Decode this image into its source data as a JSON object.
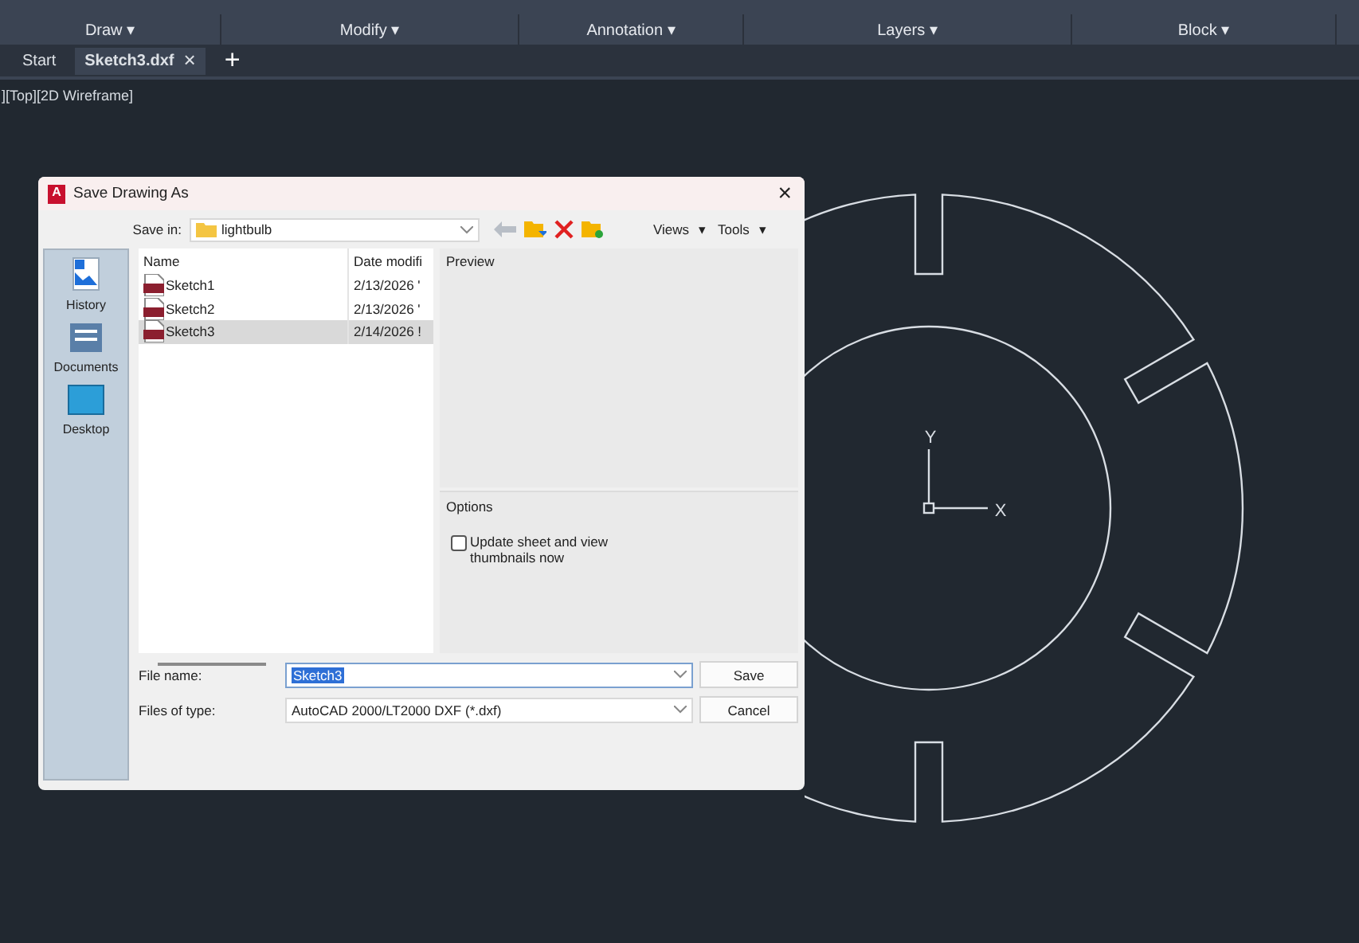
{
  "ribbon": {
    "groups": [
      {
        "label": "Draw",
        "caret": "▾"
      },
      {
        "label": "Modify",
        "caret": "▾"
      },
      {
        "label": "Annotation",
        "caret": "▾"
      },
      {
        "label": "Layers",
        "caret": "▾"
      },
      {
        "label": "Block",
        "caret": "▾"
      }
    ]
  },
  "tabs": [
    {
      "label": "Start",
      "selected": false
    },
    {
      "label": "Sketch3.dxf",
      "selected": true,
      "close": "×"
    }
  ],
  "new_tab": "+",
  "viewport_label": "][Top][2D Wireframe]",
  "dialog": {
    "app_icon": "A",
    "title": "Save Drawing As",
    "close": "×",
    "save_in": {
      "label": "Save in:",
      "value": "lightbulb"
    },
    "toolbar": {
      "views": "Views",
      "views_caret": "▾",
      "tools": "Tools",
      "tools_caret": "▾"
    },
    "places": [
      {
        "label": "History",
        "kind": "history"
      },
      {
        "label": "Documents",
        "kind": "documents"
      },
      {
        "label": "Desktop",
        "kind": "desktop"
      }
    ],
    "columns": [
      "Name",
      "Date modifi"
    ],
    "files": [
      {
        "name": "Sketch1",
        "date": "2/13/2026 '",
        "selected": false
      },
      {
        "name": "Sketch2",
        "date": "2/13/2026 '",
        "selected": false
      },
      {
        "name": "Sketch3",
        "date": "2/14/2026 !",
        "selected": true
      }
    ],
    "preview_label": "Preview",
    "options_label": "Options",
    "option": {
      "label": "Update sheet and view thumbnails now",
      "checked": false
    },
    "file_name": {
      "label": "File name:",
      "value": "Sketch3"
    },
    "file_type": {
      "label": "Files of type:",
      "value": "AutoCAD 2000/LT2000 DXF (*.dxf)"
    },
    "buttons": [
      "Save",
      "Cancel"
    ]
  },
  "axes": {
    "x": "X",
    "y": "Y"
  }
}
